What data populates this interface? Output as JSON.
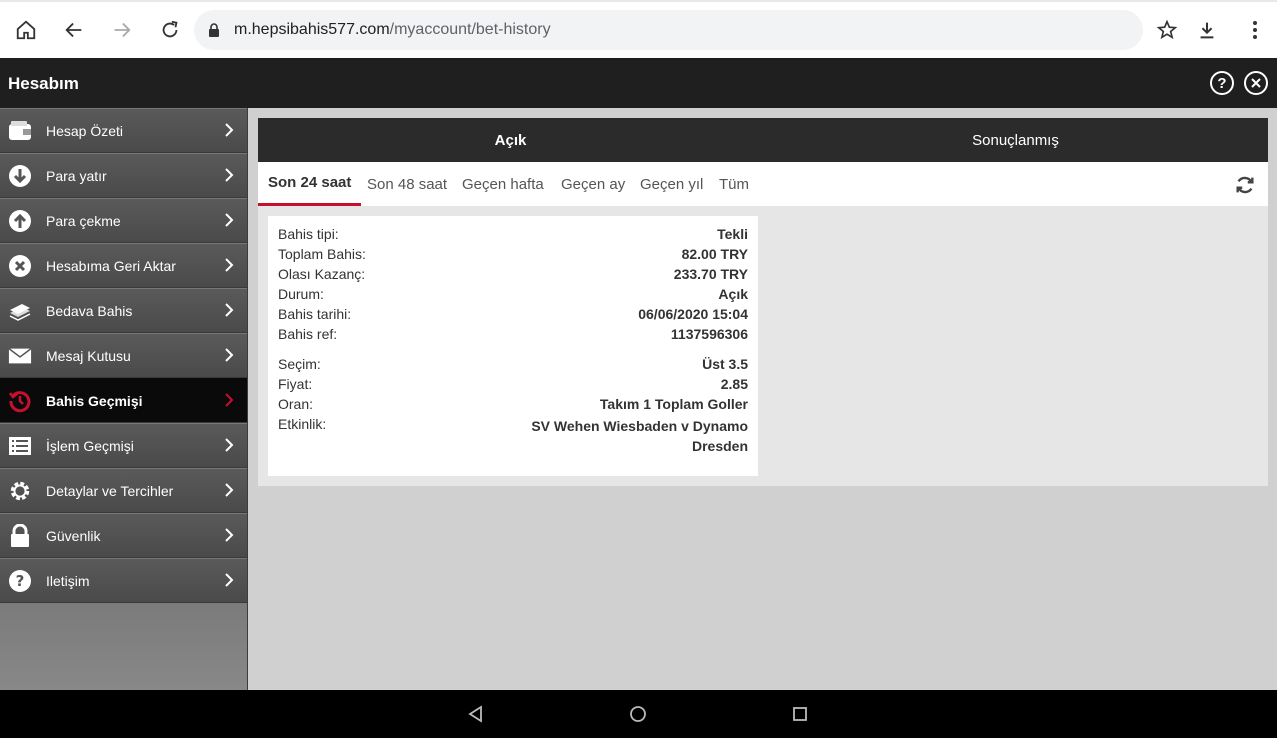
{
  "browser": {
    "url_domain": "m.hepsibahis577.com",
    "url_path": "/myaccount/bet-history"
  },
  "header": {
    "title": "Hesabım",
    "help_icon": "help-icon",
    "close_icon": "close-icon"
  },
  "sidebar": {
    "items": [
      {
        "label": "Hesap Özeti",
        "icon": "wallet-icon"
      },
      {
        "label": "Para yatır",
        "icon": "deposit-icon"
      },
      {
        "label": "Para çekme",
        "icon": "withdraw-icon"
      },
      {
        "label": "Hesabıma Geri Aktar",
        "icon": "transfer-back-icon"
      },
      {
        "label": "Bedava Bahis",
        "icon": "free-bet-icon"
      },
      {
        "label": "Mesaj Kutusu",
        "icon": "mail-icon"
      },
      {
        "label": "Bahis Geçmişi",
        "icon": "history-icon",
        "active": true
      },
      {
        "label": "İşlem Geçmişi",
        "icon": "transactions-icon"
      },
      {
        "label": "Detaylar ve Tercihler",
        "icon": "gear-icon"
      },
      {
        "label": "Güvenlik",
        "icon": "lock-icon"
      },
      {
        "label": "Iletişim",
        "icon": "question-icon"
      }
    ]
  },
  "tabs": {
    "open": "Açık",
    "settled": "Sonuçlanmış"
  },
  "filters": [
    "Son 24 saat",
    "Son 48 saat",
    "Geçen hafta",
    "Geçen ay",
    "Geçen yıl",
    "Tüm"
  ],
  "bet": {
    "type_label": "Bahis tipi:",
    "type_value": "Tekli",
    "stake_label": "Toplam Bahis:",
    "stake_value": "82.00 TRY",
    "potential_label": "Olası Kazanç:",
    "potential_value": "233.70 TRY",
    "status_label": "Durum:",
    "status_value": "Açık",
    "date_label": "Bahis tarihi:",
    "date_value": "06/06/2020 15:04",
    "ref_label": "Bahis ref:",
    "ref_value": "1137596306",
    "selection_label": "Seçim:",
    "selection_value": "Üst 3.5",
    "price_label": "Fiyat:",
    "price_value": "2.85",
    "market_label": "Oran:",
    "market_value": "Takım 1 Toplam Goller",
    "event_label": "Etkinlik:",
    "event_value": "SV Wehen Wiesbaden v Dynamo Dresden"
  },
  "colors": {
    "accent": "#c8102e",
    "header_bg": "#1f1f1f",
    "tab_bg": "#2b2b2b"
  }
}
